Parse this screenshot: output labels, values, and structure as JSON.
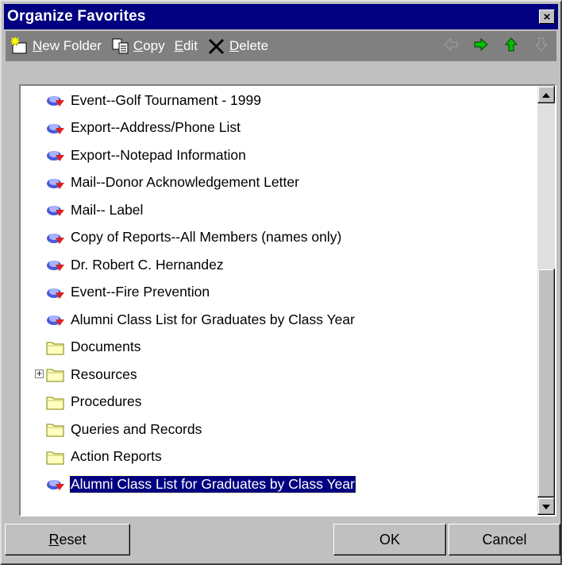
{
  "window": {
    "title": "Organize Favorites",
    "close_symbol": "×"
  },
  "toolbar": {
    "new_folder": {
      "prefix": "",
      "accel": "N",
      "rest": "ew Folder"
    },
    "copy": {
      "accel": "C",
      "rest": "opy"
    },
    "edit": {
      "accel": "E",
      "rest": "dit"
    },
    "delete": {
      "accel": "D",
      "rest": "elete"
    },
    "arrows": [
      "left-arrow-icon",
      "right-arrow-icon",
      "up-arrow-icon",
      "down-arrow-icon"
    ]
  },
  "list": {
    "items": [
      {
        "label": "Event--Golf Tournament - 1999",
        "icon": "report-icon"
      },
      {
        "label": "Export--Address/Phone List",
        "icon": "report-icon"
      },
      {
        "label": "Export--Notepad Information",
        "icon": "report-icon"
      },
      {
        "label": "Mail--Donor Acknowledgement Letter",
        "icon": "report-icon"
      },
      {
        "label": "Mail-- Label",
        "icon": "report-icon"
      },
      {
        "label": "Copy of Reports--All Members (names only)",
        "icon": "report-icon"
      },
      {
        "label": "Dr. Robert C. Hernandez",
        "icon": "report-icon"
      },
      {
        "label": "Event--Fire Prevention",
        "icon": "report-icon"
      },
      {
        "label": "Alumni Class List for Graduates by Class Year",
        "icon": "report-icon"
      },
      {
        "label": "Documents",
        "icon": "folder-icon"
      },
      {
        "label": "Resources",
        "icon": "folder-icon",
        "expander": "+"
      },
      {
        "label": "Procedures",
        "icon": "folder-icon"
      },
      {
        "label": "Queries and Records",
        "icon": "folder-icon"
      },
      {
        "label": "Action Reports",
        "icon": "folder-icon"
      },
      {
        "label": "Alumni Class List for Graduates by Class Year",
        "icon": "report-icon",
        "selected": true
      }
    ],
    "scroll_position": 0.58
  },
  "buttons": {
    "reset": {
      "accel": "R",
      "rest": "eset"
    },
    "ok": "OK",
    "cancel": "Cancel"
  },
  "colors": {
    "titlebar": "#000080",
    "toolbar": "#808080",
    "face": "#c0c0c0",
    "selection": "#000080"
  }
}
